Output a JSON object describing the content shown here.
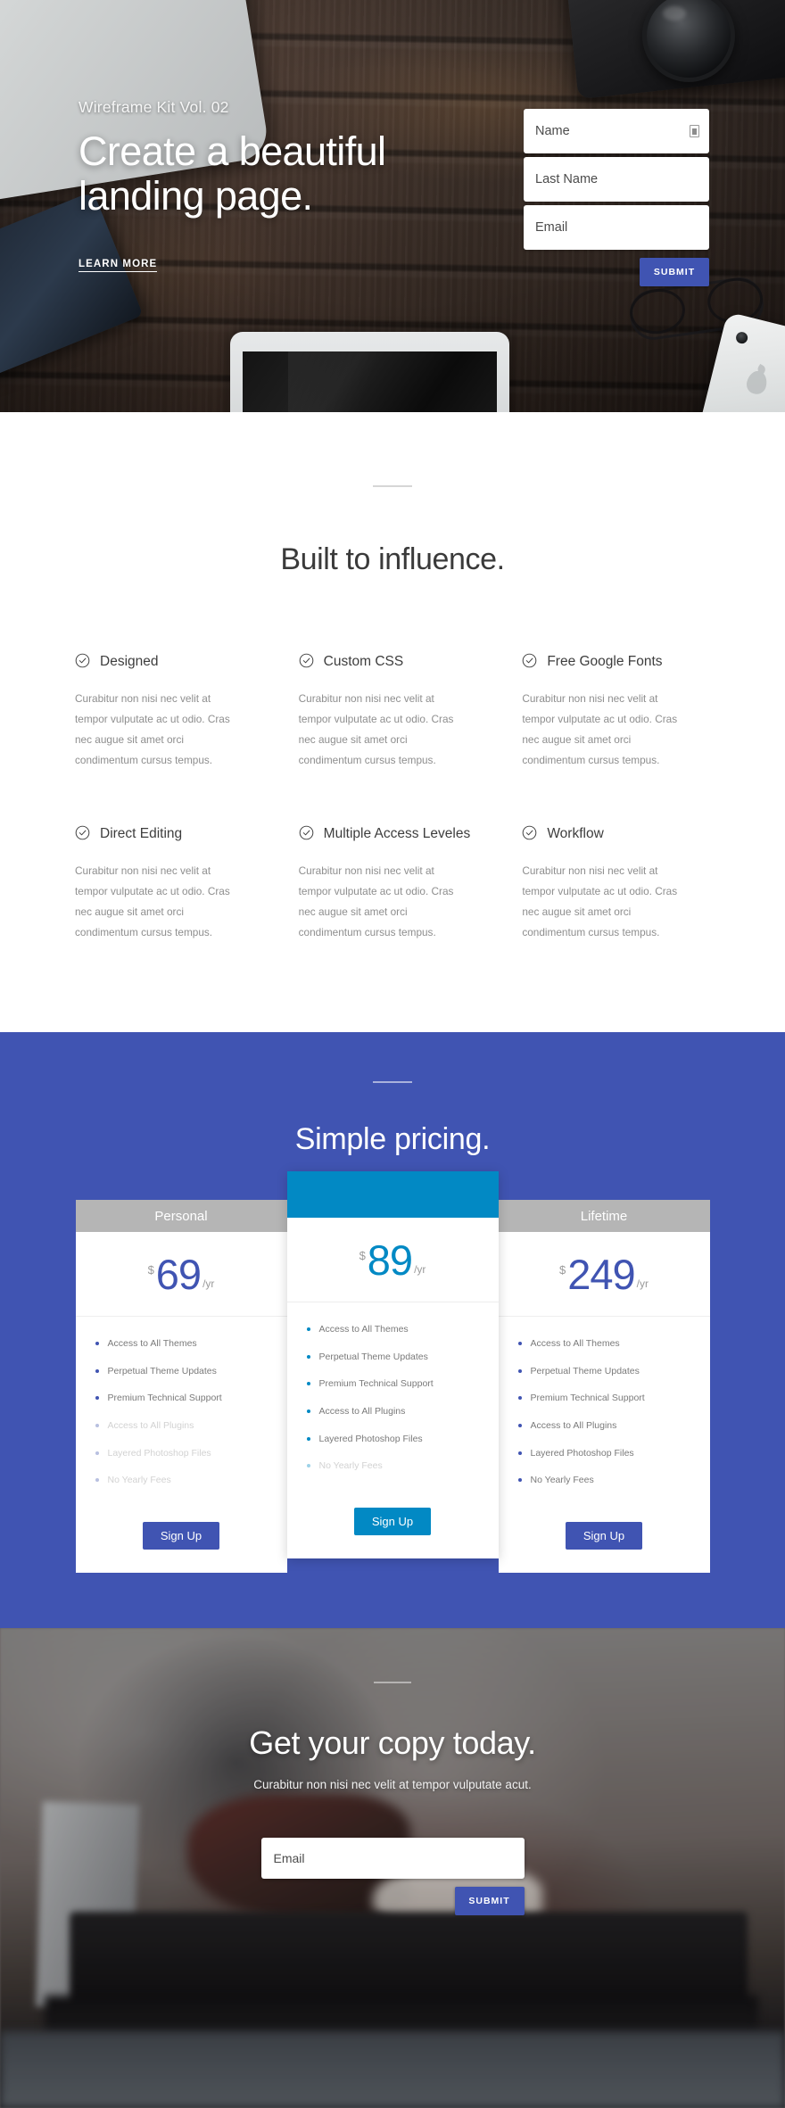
{
  "theme": {
    "brand_blue": "#4054b2",
    "featured_cyan": "#0289c4",
    "card_head_gray": "#b5b5b5",
    "body_text_gray": "#8e8e8e",
    "heading_gray": "#3a3a3a"
  },
  "hero": {
    "eyebrow": "Wireframe Kit Vol. 02",
    "title": "Create a beautiful landing page.",
    "learn_more_label": "LEARN MORE",
    "form": {
      "name_placeholder": "Name",
      "last_name_placeholder": "Last Name",
      "email_placeholder": "Email",
      "submit_label": "SUBMIT",
      "name_field_icon": "autofill-icon"
    }
  },
  "features": {
    "title": "Built to influence.",
    "check_icon": "check-circle-icon",
    "items": [
      {
        "name": "Designed",
        "body": "Curabitur non nisi nec velit at tempor vulputate ac ut odio. Cras nec augue sit amet orci condimentum cursus tempus."
      },
      {
        "name": "Custom CSS",
        "body": "Curabitur non nisi nec velit at tempor vulputate ac ut odio. Cras nec augue sit amet orci condimentum cursus tempus."
      },
      {
        "name": "Free Google Fonts",
        "body": "Curabitur non nisi nec velit at tempor vulputate ac ut odio. Cras nec augue sit amet orci condimentum cursus tempus."
      },
      {
        "name": "Direct Editing",
        "body": "Curabitur non nisi nec velit at tempor vulputate ac ut odio. Cras nec augue sit amet orci condimentum cursus tempus."
      },
      {
        "name": "Multiple Access Leveles",
        "body": "Curabitur non nisi nec velit at tempor vulputate ac ut odio. Cras nec augue sit amet orci condimentum cursus tempus."
      },
      {
        "name": "Workflow",
        "body": "Curabitur non nisi nec velit at tempor vulputate ac ut odio. Cras nec augue sit amet orci condimentum cursus tempus."
      }
    ]
  },
  "pricing": {
    "title": "Simple pricing.",
    "signup_label": "Sign Up",
    "plans": [
      {
        "name": "Personal",
        "currency": "$",
        "amount": "69",
        "period": "/yr",
        "featured": false,
        "features": [
          {
            "label": "Access to All Themes",
            "included": true
          },
          {
            "label": "Perpetual Theme Updates",
            "included": true
          },
          {
            "label": "Premium Technical Support",
            "included": true
          },
          {
            "label": "Access to All Plugins",
            "included": false
          },
          {
            "label": "Layered Photoshop Files",
            "included": false
          },
          {
            "label": "No Yearly Fees",
            "included": false
          }
        ]
      },
      {
        "name": "",
        "currency": "$",
        "amount": "89",
        "period": "/yr",
        "featured": true,
        "features": [
          {
            "label": "Access to All Themes",
            "included": true
          },
          {
            "label": "Perpetual Theme Updates",
            "included": true
          },
          {
            "label": "Premium Technical Support",
            "included": true
          },
          {
            "label": "Access to All Plugins",
            "included": true
          },
          {
            "label": "Layered Photoshop Files",
            "included": true
          },
          {
            "label": "No Yearly Fees",
            "included": false
          }
        ]
      },
      {
        "name": "Lifetime",
        "currency": "$",
        "amount": "249",
        "period": "/yr",
        "featured": false,
        "features": [
          {
            "label": "Access to All Themes",
            "included": true
          },
          {
            "label": "Perpetual Theme Updates",
            "included": true
          },
          {
            "label": "Premium Technical Support",
            "included": true
          },
          {
            "label": "Access to All Plugins",
            "included": true
          },
          {
            "label": "Layered Photoshop Files",
            "included": true
          },
          {
            "label": "No Yearly Fees",
            "included": true
          }
        ]
      }
    ]
  },
  "cta": {
    "title": "Get your copy today.",
    "subtitle": "Curabitur non nisi nec velit at tempor vulputate acut.",
    "email_placeholder": "Email",
    "submit_label": "SUBMIT"
  }
}
